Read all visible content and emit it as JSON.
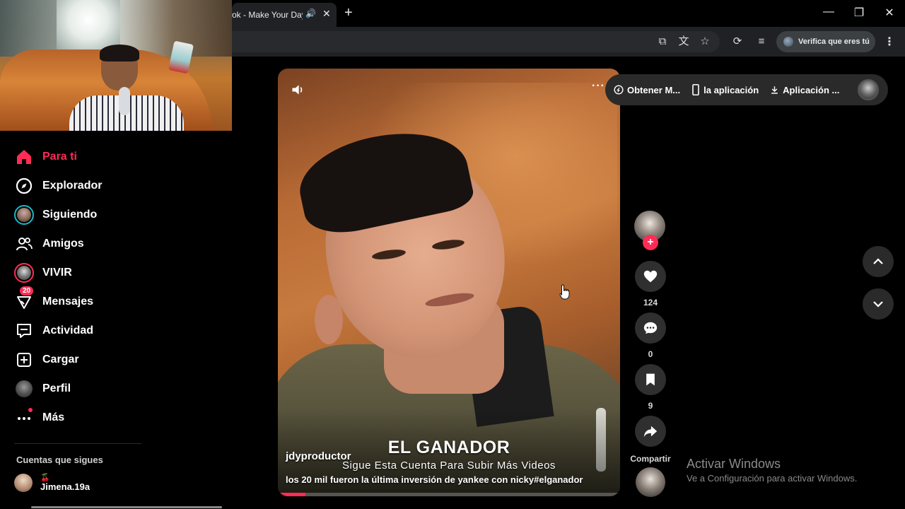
{
  "browser": {
    "tab_title": "ok - Make Your Day",
    "new_tab_symbol": "+",
    "verify_label": "Verifica que eres tú",
    "window_controls": [
      "minimize-icon",
      "restore-icon",
      "close-icon"
    ]
  },
  "sidebar": {
    "items": [
      {
        "label": "Para ti",
        "icon": "home-icon",
        "active": true
      },
      {
        "label": "Explorador",
        "icon": "compass-icon"
      },
      {
        "label": "Siguiendo",
        "icon": "avatar"
      },
      {
        "label": "Amigos",
        "icon": "friends-icon"
      },
      {
        "label": "VIVIR",
        "icon": "live-avatar"
      },
      {
        "label": "Mensajes",
        "icon": "inbox-icon",
        "badge": "20"
      },
      {
        "label": "Actividad",
        "icon": "activity-icon"
      },
      {
        "label": "Cargar",
        "icon": "upload-icon"
      },
      {
        "label": "Perfil",
        "icon": "profile-avatar"
      },
      {
        "label": "Más",
        "icon": "more-icon"
      }
    ],
    "following_title": "Cuentas que sigues",
    "following": [
      {
        "emoji": "🍒",
        "name": "Jimena.19a"
      }
    ]
  },
  "video": {
    "title_overlay": "EL GANADOR",
    "subtitle_overlay": "Sigue Esta Cuenta Para Subir Más Videos",
    "author": "jdyproductor",
    "description": "los 20 mil fueron la última inversión de yankee con nicky#elganador",
    "progress": 0.08
  },
  "actions": {
    "likes": "124",
    "comments": "0",
    "saves": "9",
    "share_label": "Compartir",
    "follow_symbol": "+"
  },
  "top_pill": {
    "items": [
      {
        "label": "Obtener M...",
        "icon": "coin-icon"
      },
      {
        "label": "la aplicación",
        "icon": "phone-icon"
      },
      {
        "label": "Aplicación ...",
        "icon": "download-icon"
      }
    ]
  },
  "watermark": {
    "title": "Activar Windows",
    "subtitle": "Ve a Configuración para activar Windows."
  },
  "colors": {
    "accent": "#fe2c55",
    "background": "#000000",
    "chrome": "#202124"
  }
}
